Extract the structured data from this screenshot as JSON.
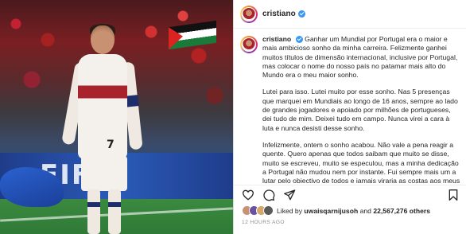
{
  "post": {
    "username": "cristiano",
    "photo": {
      "board_text": "FIFA",
      "jersey_number": "7"
    },
    "caption": {
      "username": "cristiano",
      "paragraphs": [
        "Ganhar um Mundial por Portugal era o maior e mais ambicioso sonho da minha carreira. Felizmente ganhei muitos títulos de dimensão internacional, inclusive por Portugal, mas colocar o nome do nosso país no patamar mais alto do Mundo era o meu maior sonho.",
        "Lutei para isso. Lutei muito por esse sonho. Nas 5 presenças que marquei em Mundiais ao longo de 16 anos, sempre ao lado de grandes jogadores e apoiado por milhões de portugueses, dei tudo de mim. Deixei tudo em campo. Nunca virei a cara à luta e nunca desisti desse sonho.",
        "Infelizmente, ontem o sonho acabou. Não vale a pena reagir a quente. Quero apenas que todos saibam que muito se disse, muito se escreveu, muito se especulou, mas a minha dedicação a Portugal não mudou nem por instante. Fui sempre mais um a lutar pelo objectivo de todos e jamais viraria as costas aos meus"
      ]
    },
    "likes": {
      "prefix": "Liked by",
      "first_user": "uwaisqarnijusoh",
      "connector": "and",
      "count_text": "22,567,276 others"
    },
    "timestamp": "12 HOURS AGO",
    "icons": [
      "heart-icon",
      "comment-icon",
      "share-icon",
      "bookmark-icon",
      "verified-badge-icon"
    ],
    "colors": {
      "verified": "#3897f0",
      "text": "#262626",
      "muted": "#8e8e8e",
      "jersey_red": "#a8232b"
    }
  }
}
